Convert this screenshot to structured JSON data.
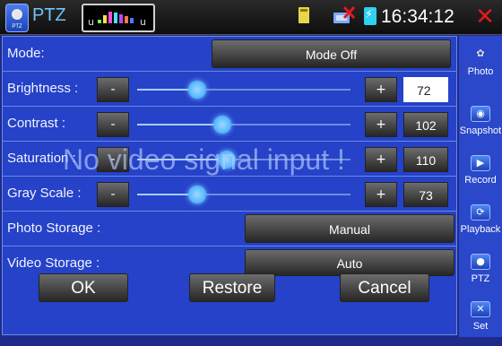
{
  "topbar": {
    "app_icon": "ptz-camera-icon",
    "app_icon_caption": "PTZ",
    "app_title": "PTZ",
    "signal_icon": "rs485-signal-icon",
    "signal_glyph_1": "u",
    "signal_glyph_2": "u",
    "status_icons": [
      "sd-card-icon",
      "network-disconnected-icon",
      "battery-charging-icon"
    ],
    "time": "16:34:12",
    "close_icon": "close-icon",
    "close_glyph": "✕"
  },
  "settings": {
    "mode": {
      "label": "Mode:",
      "value": "Mode Off"
    },
    "brightness": {
      "label": "Brightness :",
      "value": "72",
      "level_percent": 28
    },
    "contrast": {
      "label": "Contrast :",
      "value": "102",
      "level_percent": 40
    },
    "saturation": {
      "label": "Saturation :",
      "value": "110",
      "level_percent": 42
    },
    "gray_scale": {
      "label": "Gray Scale :",
      "value": "73",
      "level_percent": 28
    },
    "minus_label": "-",
    "plus_label": "+",
    "photo_storage": {
      "label": "Photo Storage :",
      "value": "Manual"
    },
    "video_storage": {
      "label": "Video Storage :",
      "value": "Auto"
    }
  },
  "overlay_text": "No video signal input !",
  "buttons": {
    "ok": "OK",
    "restore": "Restore",
    "cancel": "Cancel"
  },
  "sidebar": [
    {
      "label": "Photo",
      "icon": "photo-icon",
      "glyph": "✿"
    },
    {
      "label": "Snapshot",
      "icon": "camera-icon",
      "glyph": "◉"
    },
    {
      "label": "Record",
      "icon": "record-icon",
      "glyph": "▶"
    },
    {
      "label": "Playback",
      "icon": "playback-icon",
      "glyph": "⟳"
    },
    {
      "label": "PTZ",
      "icon": "ptz-icon",
      "glyph": "●"
    },
    {
      "label": "Set",
      "icon": "settings-icon",
      "glyph": "✕"
    }
  ],
  "colors": {
    "panel_bg": "#2542c8",
    "slider_knob": "#2aa4ff",
    "close_red": "#e21a1a",
    "title_blue": "#6ec4ff"
  }
}
